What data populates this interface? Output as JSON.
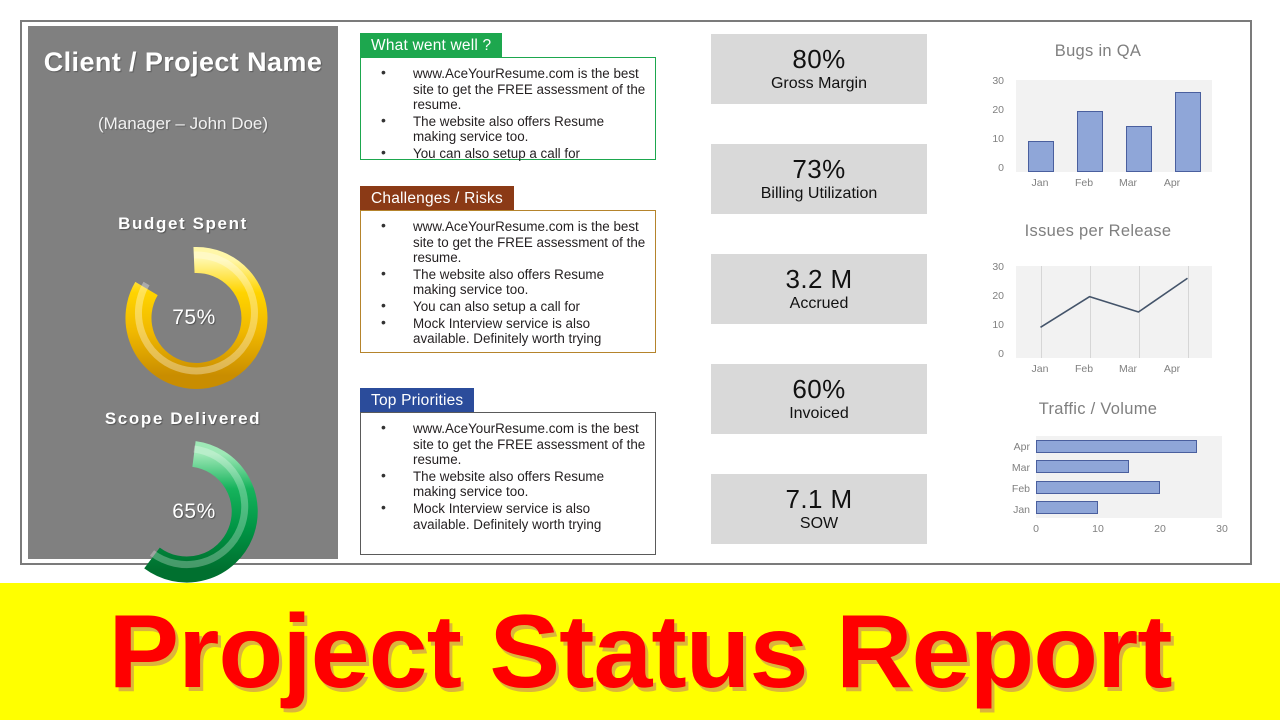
{
  "slide": {
    "sidebar": {
      "project_title": "Client / Project Name",
      "manager_line": "(Manager – John Doe)",
      "gauges": [
        {
          "label": "Budget  Spent",
          "value": 75,
          "value_label": "75%",
          "color": "#f5c400",
          "name": "budget-spent-gauge"
        },
        {
          "label": "Scope Delivered",
          "value": 65,
          "value_label": "65%",
          "color": "#00a651",
          "name": "scope-delivered-gauge"
        }
      ]
    },
    "panels": [
      {
        "title": "What went well ?",
        "header_color": "#1da74e",
        "border_color": "#1da74e",
        "bullets": [
          "www.AceYourResume.com is the best site to get the FREE assessment of the resume.",
          "The website also offers Resume making service too.",
          "You can also setup a call for"
        ]
      },
      {
        "title": "Challenges / Risks",
        "header_color": "#8b3a16",
        "border_color": "#b5842c",
        "bullets": [
          "www.AceYourResume.com is the best site to get the FREE assessment of the resume.",
          "The website also offers Resume making service too.",
          "You can also setup a call for",
          "Mock Interview service is also available. Definitely worth trying"
        ]
      },
      {
        "title": "Top Priorities",
        "header_color": "#2b4c9b",
        "border_color": "#5a5a5a",
        "bullets": [
          "www.AceYourResume.com is the best site to get the FREE assessment of the resume.",
          "The website also offers Resume making service too.",
          "Mock Interview service is also available. Definitely worth trying"
        ]
      }
    ],
    "kpis": [
      {
        "value": "80%",
        "caption": "Gross Margin"
      },
      {
        "value": "73%",
        "caption": "Billing Utilization"
      },
      {
        "value": "3.2 M",
        "caption": "Accrued"
      },
      {
        "value": "60%",
        "caption": "Invoiced"
      },
      {
        "value": "7.1 M",
        "caption": "SOW"
      }
    ],
    "banner": {
      "text": "Project Status Report",
      "background": "#ffff00",
      "text_color": "#ff0000"
    }
  },
  "chart_data": [
    {
      "type": "bar",
      "title": "Bugs in QA",
      "categories": [
        "Jan",
        "Feb",
        "Mar",
        "Apr"
      ],
      "values": [
        10,
        20,
        15,
        26
      ],
      "xlabel": "",
      "ylabel": "",
      "ylim": [
        0,
        30
      ],
      "yticks": [
        0,
        10,
        20,
        30
      ],
      "grid": false,
      "legend": "none",
      "series_color": "#8fa6d8"
    },
    {
      "type": "line",
      "title": "Issues per Release",
      "categories": [
        "Jan",
        "Feb",
        "Mar",
        "Apr"
      ],
      "values": [
        10,
        20,
        15,
        26
      ],
      "xlabel": "",
      "ylabel": "",
      "ylim": [
        0,
        30
      ],
      "yticks": [
        0,
        10,
        20,
        30
      ],
      "grid": true,
      "legend": "none",
      "series_color": "#44546a"
    },
    {
      "type": "bar",
      "orientation": "horizontal",
      "title": "Traffic / Volume",
      "categories": [
        "Jan",
        "Feb",
        "Mar",
        "Apr"
      ],
      "values": [
        10,
        20,
        15,
        26
      ],
      "xlabel": "",
      "ylabel": "",
      "xlim": [
        0,
        30
      ],
      "xticks": [
        0,
        10,
        20,
        30
      ],
      "grid": false,
      "legend": "none",
      "series_color": "#8fa6d8"
    }
  ]
}
